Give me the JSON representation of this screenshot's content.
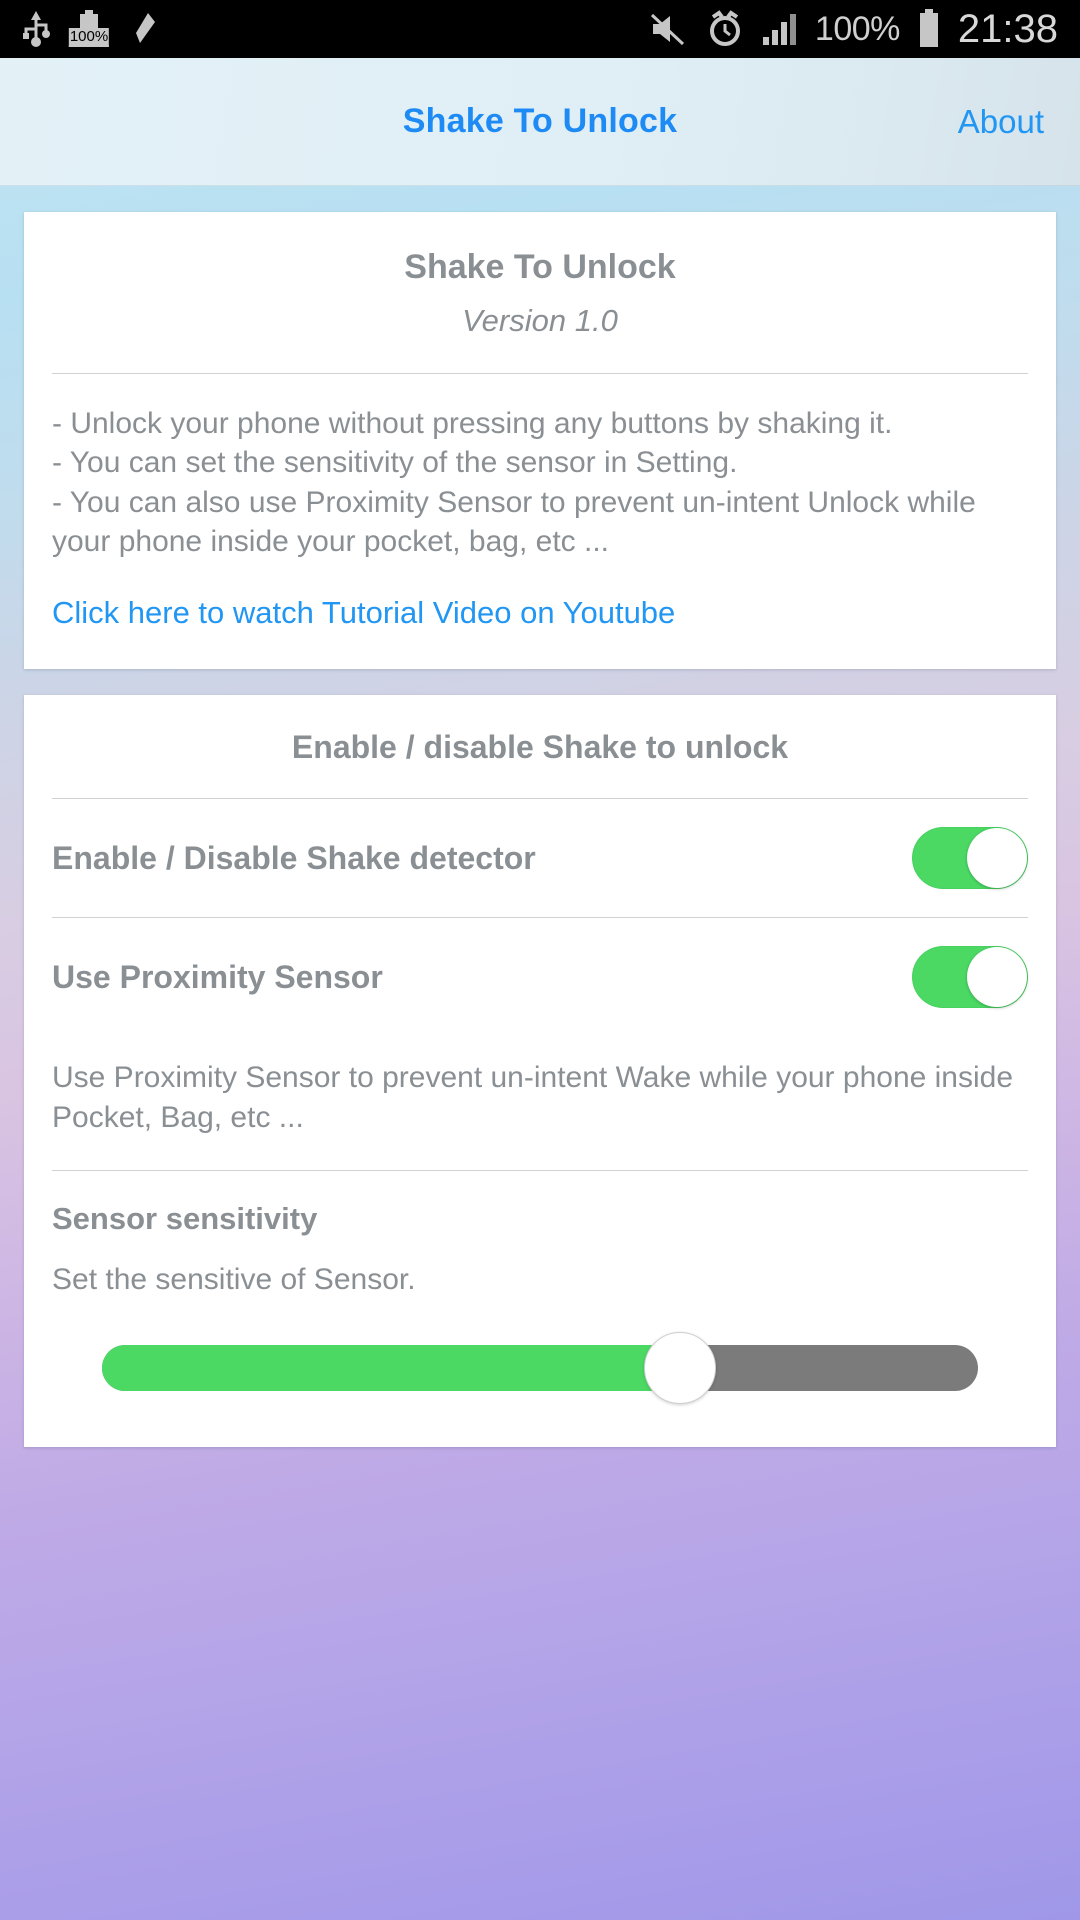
{
  "statusbar": {
    "icons_left": [
      "usb-icon",
      "battery-100-icon",
      "pen-icon"
    ],
    "icons_right": [
      "mute-icon",
      "alarm-icon",
      "signal-icon"
    ],
    "battery_label": "100%",
    "battery_small_label": "100%",
    "clock": "21:38"
  },
  "actionbar": {
    "title": "Shake To Unlock",
    "action_label": "About",
    "title_color": "#1e8bf5",
    "action_color": "#2196f3"
  },
  "about_card": {
    "app_title": "Shake To Unlock",
    "version": "Version 1.0",
    "features": [
      "- Unlock your phone without pressing any buttons by shaking it.",
      "- You can set the sensitivity of the sensor in Setting.",
      "- You can also use Proximity Sensor to prevent un-intent Unlock while your phone inside your pocket, bag, etc ..."
    ],
    "link_label": "Click here to watch Tutorial Video on Youtube"
  },
  "settings_card": {
    "section_title": "Enable / disable Shake to unlock",
    "rows": [
      {
        "label": "Enable / Disable Shake detector",
        "toggle_on": true
      },
      {
        "label": "Use Proximity Sensor",
        "toggle_on": true
      }
    ],
    "proximity_note": "Use Proximity Sensor to prevent un-intent Wake while your phone inside Pocket, Bag, etc ...",
    "sensitivity_heading": "Sensor sensitivity",
    "sensitivity_description": "Set the sensitive of Sensor.",
    "sensitivity_percent": 66
  },
  "colors": {
    "accent_green": "#4bd964",
    "track_gray": "#7b7b7b",
    "text_gray": "#8a8f94",
    "link_blue": "#2196f3"
  }
}
